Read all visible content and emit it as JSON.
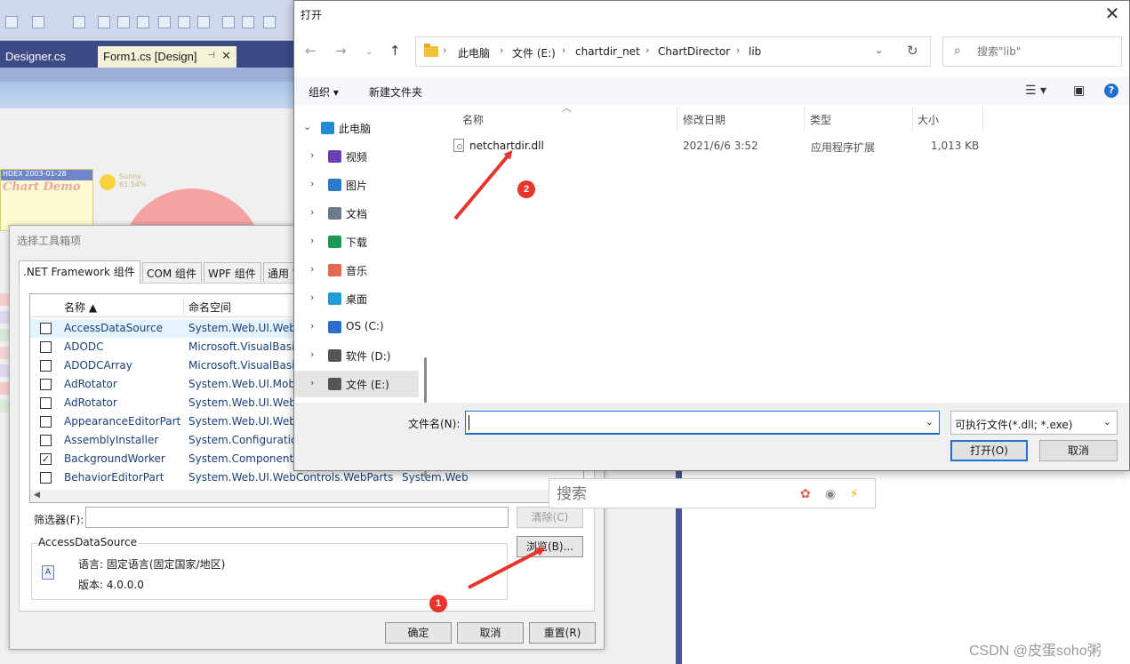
{
  "vs": {
    "tabs": [
      {
        "label": "Designer.cs"
      },
      {
        "label": "Form1.cs [Design]"
      }
    ],
    "chart_demo": {
      "header": "HDEX  2003-01-28",
      "title": "Chart Demo"
    },
    "weather": {
      "label": "Sunny",
      "percent": "61.54%"
    }
  },
  "toolbox": {
    "title": "选择工具箱项",
    "tabs": [
      ".NET Framework 组件",
      "COM 组件",
      "WPF 组件",
      "通用 W"
    ],
    "columns": [
      "名称",
      "命名空间"
    ],
    "rows": [
      {
        "name": "AccessDataSource",
        "ns": "System.Web.UI.Web",
        "asm": "",
        "checked": false,
        "selected": true
      },
      {
        "name": "ADODC",
        "ns": "Microsoft.VisualBasi",
        "asm": "",
        "checked": false,
        "selected": false
      },
      {
        "name": "ADODCArray",
        "ns": "Microsoft.VisualBasi",
        "asm": "",
        "checked": false,
        "selected": false
      },
      {
        "name": "AdRotator",
        "ns": "System.Web.UI.Mob",
        "asm": "",
        "checked": false,
        "selected": false
      },
      {
        "name": "AdRotator",
        "ns": "System.Web.UI.Web",
        "asm": "",
        "checked": false,
        "selected": false
      },
      {
        "name": "AppearanceEditorPart",
        "ns": "System.Web.UI.Web",
        "asm": "",
        "checked": false,
        "selected": false
      },
      {
        "name": "AssemblyInstaller",
        "ns": "System.Configuration",
        "asm": "",
        "checked": false,
        "selected": false
      },
      {
        "name": "BackgroundWorker",
        "ns": "System.ComponentM",
        "asm": "",
        "checked": true,
        "selected": false
      },
      {
        "name": "BehaviorEditorPart",
        "ns": "System.Web.UI.WebControls.WebParts",
        "asm": "System.Web",
        "checked": false,
        "selected": false
      }
    ],
    "filter_label": "筛选器(F):",
    "filter_value": "",
    "clear_label": "清除(C)",
    "browse_label": "浏览(B)...",
    "info_title": "AccessDataSource",
    "language_line": "语言:  固定语言(固定国家/地区)",
    "version_line": "版本:  4.0.0.0",
    "ok_label": "确定",
    "cancel_label": "取消",
    "reset_label": "重置(R)"
  },
  "open_dialog": {
    "title": "打开",
    "breadcrumbs": [
      "此电脑",
      "文件 (E:)",
      "chartdir_net",
      "ChartDirector",
      "lib"
    ],
    "search_placeholder": "搜索\"lib\"",
    "organize_label": "组织 ▾",
    "new_folder_label": "新建文件夹",
    "nav_items": [
      {
        "label": "此电脑",
        "icon": "computer-icon",
        "color": "#1f8ad6",
        "expanded": true
      },
      {
        "label": "视频",
        "icon": "video-icon",
        "color": "#6a3fb5"
      },
      {
        "label": "图片",
        "icon": "picture-icon",
        "color": "#2a7bd0"
      },
      {
        "label": "文档",
        "icon": "document-icon",
        "color": "#6d7a8a"
      },
      {
        "label": "下载",
        "icon": "download-icon",
        "color": "#1c9a55"
      },
      {
        "label": "音乐",
        "icon": "music-icon",
        "color": "#e06a4a"
      },
      {
        "label": "桌面",
        "icon": "desktop-icon",
        "color": "#1f9bd6"
      },
      {
        "label": "OS (C:)",
        "icon": "os-drive-icon",
        "color": "#2a6fd0"
      },
      {
        "label": "软件 (D:)",
        "icon": "drive-icon",
        "color": "#555555"
      },
      {
        "label": "文件 (E:)",
        "icon": "drive-icon",
        "color": "#555555",
        "selected": true
      }
    ],
    "columns": [
      "名称",
      "修改日期",
      "类型",
      "大小"
    ],
    "files": [
      {
        "name": "netchartdir.dll",
        "modified": "2021/6/6 3:52",
        "type": "应用程序扩展",
        "size": "1,013 KB"
      }
    ],
    "filename_label": "文件名(N):",
    "filename_value": "",
    "filetype_value": "可执行文件(*.dll; *.exe)",
    "open_label": "打开(O)",
    "cancel_label": "取消"
  },
  "float_search": {
    "placeholder": "搜索"
  },
  "annotations": {
    "badge1": "1",
    "badge2": "2",
    "color": "#e8342c"
  },
  "watermark": "CSDN @皮蛋soho粥"
}
